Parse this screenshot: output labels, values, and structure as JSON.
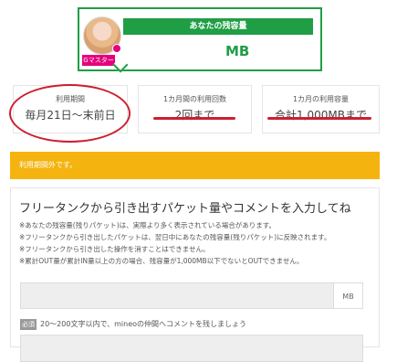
{
  "remaining": {
    "title": "あなたの残容量",
    "unit": "MB",
    "badge": "Gマスター"
  },
  "stats": [
    {
      "label": "利用期間",
      "value": "毎月21日〜末前日"
    },
    {
      "label": "1カ月間の利用回数",
      "value": "2回まで"
    },
    {
      "label": "1カ月の利用容量",
      "value": "合計1,000MBまで"
    }
  ],
  "notice": "利用期間外です。",
  "form": {
    "title": "フリータンクから引き出すパケット量やコメントを入力してね",
    "notes": [
      "※あなたの残容量(残りパケット)は、実際より多く表示されている場合があります。",
      "※フリータンクから引き出したパケットは、翌日中にあなたの残容量(残りパケット)に反映されます。",
      "※フリータンクから引き出した操作を消すことはできません。",
      "※累計OUT量が累計IN量以上の方の場合、残容量が1,000MB以下でないとOUTできません。"
    ],
    "amount_unit": "MB",
    "required_label": "必須",
    "comment_hint": "20〜200文字以内で、mineoの仲間へコメントを残しましょう"
  },
  "colors": {
    "brand_green": "#1f9e45",
    "accent_pink": "#e6007e",
    "notice_orange": "#f4b30e",
    "annotation_red": "#cc1f2f"
  }
}
